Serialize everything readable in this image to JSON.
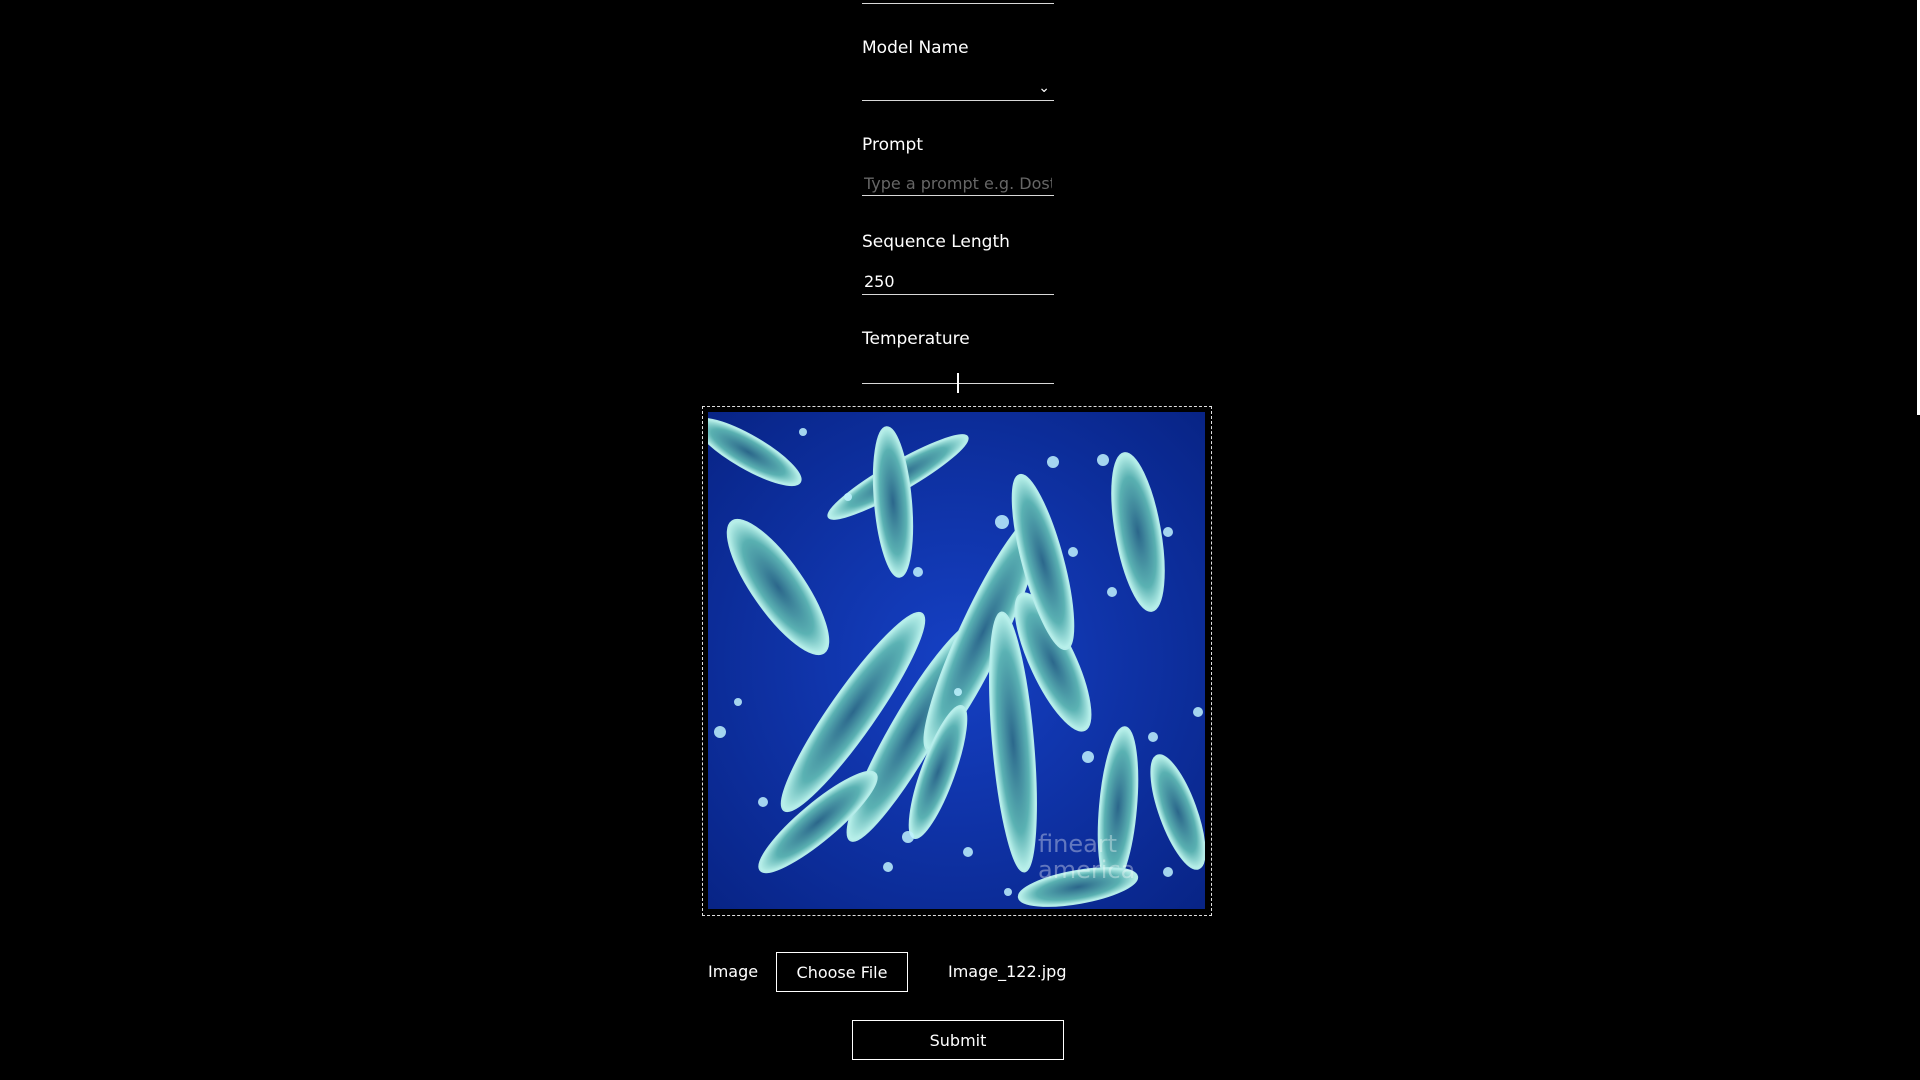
{
  "form": {
    "model_name_label": "Model Name",
    "model_name_value": "",
    "prompt_label": "Prompt",
    "prompt_placeholder": "Type a prompt e.g. Dostoevsky",
    "sequence_length_label": "Sequence Length",
    "sequence_length_value": "250",
    "temperature_label": "Temperature",
    "temperature_value_fraction": 0.5,
    "image_label": "Image",
    "choose_file_label": "Choose File",
    "file_name": "Image_122.jpg",
    "submit_label": "Submit"
  },
  "preview": {
    "watermark_line1": "fineart",
    "watermark_line2": "america"
  },
  "colors": {
    "background": "#000000",
    "text": "#ffffff",
    "image_bg": "#0a2a9c",
    "organism": "#6fd3c8"
  },
  "icons": {
    "select_chevron": "chevron-down-icon"
  }
}
